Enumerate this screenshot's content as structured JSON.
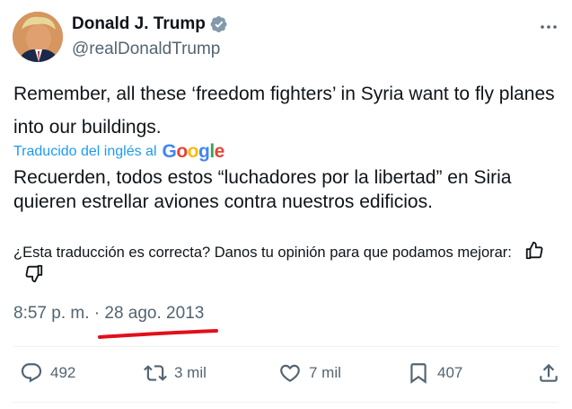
{
  "author": {
    "display_name": "Donald J. Trump",
    "handle": "@realDonaldTrump",
    "verified": true,
    "avatar": "profile-photo"
  },
  "tweet": {
    "original_text": "Remember, all these ‘freedom fighters’ in Syria want to fly planes into our buildings.",
    "translated_by_label": "Traducido del inglés al",
    "translated_by_brand": "Google",
    "translated_text": "Recuerden, todos estos “luchadores por la libertad” en Siria quieren estrellar aviones contra nuestros edificios.",
    "feedback_prompt": "¿Esta traducción es correcta? Danos tu opinión para que podamos mejorar:",
    "time": "8:57 p. m.",
    "separator": "·",
    "date": "28 ago. 2013"
  },
  "actions": {
    "replies": "492",
    "retweets": "3 mil",
    "likes": "7 mil",
    "bookmarks": "407"
  },
  "icons": {
    "more": "more-dots-icon",
    "verified": "verified-badge-icon",
    "thumbs_up": "thumbs-up-icon",
    "thumbs_down": "thumbs-down-icon",
    "reply": "reply-icon",
    "retweet": "retweet-icon",
    "like": "heart-icon",
    "bookmark": "bookmark-icon",
    "share": "share-icon"
  },
  "colors": {
    "text_primary": "#0f1419",
    "text_secondary": "#536471",
    "link_blue": "#1d9bf0",
    "annotation_red": "#e0101a"
  }
}
